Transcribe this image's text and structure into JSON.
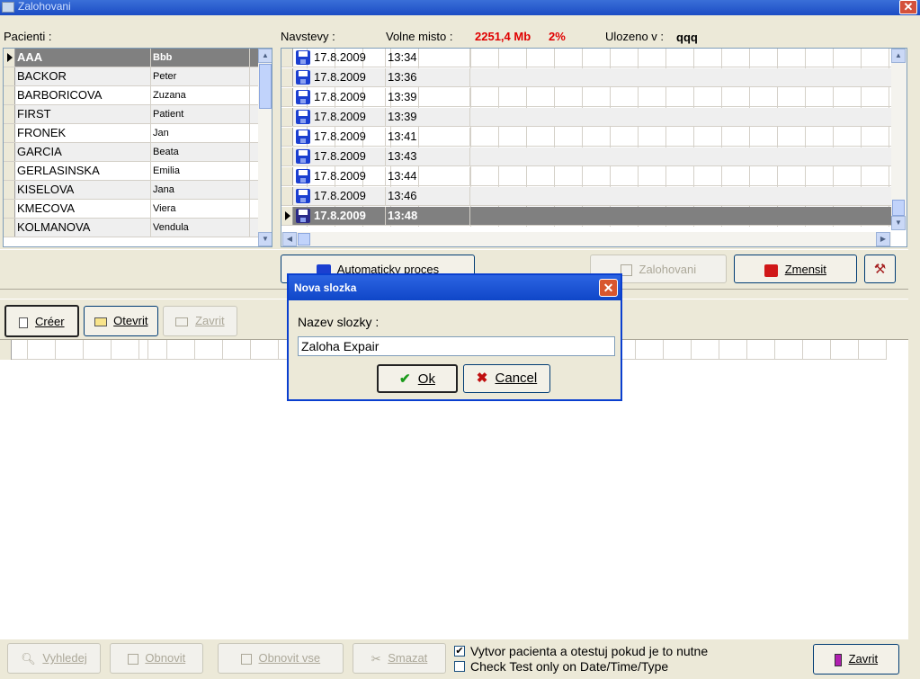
{
  "window": {
    "title": "Zalohovani",
    "close_label": "✕"
  },
  "patients": {
    "label": "Pacienti :",
    "rows": [
      {
        "last": "AAA",
        "first": "Bbb"
      },
      {
        "last": "BACKOR",
        "first": "Peter"
      },
      {
        "last": "BARBORICOVA",
        "first": "Zuzana"
      },
      {
        "last": "FIRST",
        "first": "Patient"
      },
      {
        "last": "FRONEK",
        "first": "Jan"
      },
      {
        "last": "GARCIA",
        "first": "Beata"
      },
      {
        "last": "GERLASINSKA",
        "first": "Emilia"
      },
      {
        "last": "KISELOVA",
        "first": "Jana"
      },
      {
        "last": "KMECOVA",
        "first": "Viera"
      },
      {
        "last": "KOLMANOVA",
        "first": "Vendula"
      }
    ]
  },
  "visits": {
    "label": "Navstevy :",
    "free_label": "Volne misto :",
    "free_value": "2251,4 Mb",
    "free_pct": "2%",
    "saved_label": "Ulozeno v :",
    "saved_value": "qqq",
    "rows": [
      {
        "date": "17.8.2009",
        "time": "13:34"
      },
      {
        "date": "17.8.2009",
        "time": "13:36"
      },
      {
        "date": "17.8.2009",
        "time": "13:39"
      },
      {
        "date": "17.8.2009",
        "time": "13:39"
      },
      {
        "date": "17.8.2009",
        "time": "13:41"
      },
      {
        "date": "17.8.2009",
        "time": "13:43"
      },
      {
        "date": "17.8.2009",
        "time": "13:44"
      },
      {
        "date": "17.8.2009",
        "time": "13:46"
      },
      {
        "date": "17.8.2009",
        "time": "13:48"
      }
    ]
  },
  "toolbar": {
    "auto_label": "Automaticky proces",
    "backup_label": "Zalohovani",
    "reduce_label": "Zmensit"
  },
  "folder_bar": {
    "create_label": "Créer",
    "open_label": "Otevrit",
    "close_label": "Zavrit"
  },
  "dialog": {
    "title": "Nova slozka",
    "close_label": "✕",
    "field_label": "Nazev slozky :",
    "field_value": "Zaloha Expair",
    "ok_label": "Ok",
    "cancel_label": "Cancel"
  },
  "bottom": {
    "search_label": "Vyhledej",
    "restore_label": "Obnovit",
    "restore_all_label": "Obnovit vse",
    "delete_label": "Smazat",
    "check1_label": "Vytvor pacienta a otestuj pokud je to nutne",
    "check1_checked": "✔",
    "check2_label": "Check Test only on Date/Time/Type",
    "close_label": "Zavrit"
  },
  "colors": {
    "accent_red": "#e00000",
    "selection": "#808080",
    "title_blue": "#0a3fcf"
  }
}
